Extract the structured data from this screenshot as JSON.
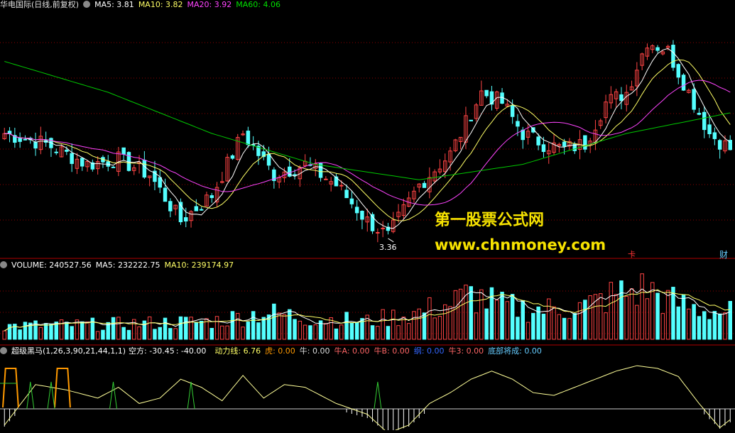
{
  "chart_data": {
    "type": "candlestick",
    "colors": {
      "up": "#ff4444",
      "down": "#54ffff",
      "ma5": "#ffffff",
      "ma10": "#ffff66",
      "ma20": "#ff44ff",
      "ma60": "#00c800",
      "grid": "#8b0000"
    },
    "main": {
      "title": "华电国际(日线,前复权)",
      "ma5_label": "MA5: 3.81",
      "ma10_label": "MA10: 3.82",
      "ma20_label": "MA20: 3.92",
      "ma60_label": "MA60: 4.06",
      "low_annotation": "3.36",
      "corner_label_left": "卡",
      "corner_label_right": "财",
      "anchors": [
        [
          0,
          4.4
        ],
        [
          8,
          4.3
        ],
        [
          16,
          4.1
        ],
        [
          22,
          4.15
        ],
        [
          28,
          4.0
        ],
        [
          34,
          3.55
        ],
        [
          40,
          3.8
        ],
        [
          46,
          4.4
        ],
        [
          52,
          4.0
        ],
        [
          58,
          4.1
        ],
        [
          64,
          3.9
        ],
        [
          70,
          3.55
        ],
        [
          74,
          3.4
        ],
        [
          80,
          3.9
        ],
        [
          86,
          4.2
        ],
        [
          92,
          4.8
        ],
        [
          96,
          4.7
        ],
        [
          100,
          4.4
        ],
        [
          104,
          4.3
        ],
        [
          108,
          4.25
        ],
        [
          112,
          4.3
        ],
        [
          116,
          4.7
        ],
        [
          120,
          4.8
        ],
        [
          124,
          5.3
        ],
        [
          128,
          5.2
        ],
        [
          132,
          4.8
        ],
        [
          136,
          4.4
        ],
        [
          140,
          4.25
        ]
      ],
      "ma60_anchors": [
        [
          0,
          5.1
        ],
        [
          20,
          4.8
        ],
        [
          40,
          4.4
        ],
        [
          60,
          4.1
        ],
        [
          80,
          3.95
        ],
        [
          100,
          4.1
        ],
        [
          120,
          4.4
        ],
        [
          140,
          4.6
        ]
      ],
      "ylim": [
        3.2,
        5.6
      ]
    },
    "volume": {
      "label": "VOLUME: 240527.56",
      "ma5_label": "MA5: 232222.75",
      "ma10_label": "MA10: 239174.97",
      "anchors": [
        [
          0,
          0.22
        ],
        [
          20,
          0.25
        ],
        [
          40,
          0.3
        ],
        [
          50,
          0.45
        ],
        [
          60,
          0.35
        ],
        [
          70,
          0.3
        ],
        [
          80,
          0.45
        ],
        [
          86,
          0.6
        ],
        [
          90,
          0.75
        ],
        [
          96,
          0.55
        ],
        [
          104,
          0.5
        ],
        [
          112,
          0.55
        ],
        [
          118,
          0.75
        ],
        [
          124,
          0.85
        ],
        [
          128,
          0.65
        ],
        [
          134,
          0.5
        ],
        [
          140,
          0.45
        ]
      ]
    },
    "indicator": {
      "name": "超级黑马(1,26,3,90,21,44,1,1)",
      "kongfang": "空方: -30.45",
      "kongfang2": ": -40.00",
      "dongli": "动力线: 6.76",
      "hu": "虎: 0.00",
      "niu": "牛: 0.00",
      "niuA": "牛A: 0.00",
      "niuB": "牛B: 0.00",
      "gang": "纲: 0.00",
      "niu3": "牛3: 0.00",
      "dibu": "底部将成: 0.00",
      "dongli_anchors": [
        [
          0,
          -0.3
        ],
        [
          6,
          0.45
        ],
        [
          12,
          0.35
        ],
        [
          18,
          0.2
        ],
        [
          22,
          0.4
        ],
        [
          26,
          0.1
        ],
        [
          30,
          0.2
        ],
        [
          34,
          0.55
        ],
        [
          38,
          0.4
        ],
        [
          42,
          0.15
        ],
        [
          46,
          0.62
        ],
        [
          50,
          0.2
        ],
        [
          54,
          0.45
        ],
        [
          58,
          0.4
        ],
        [
          64,
          0.1
        ],
        [
          70,
          -0.1
        ],
        [
          74,
          -0.45
        ],
        [
          78,
          -0.3
        ],
        [
          82,
          0.1
        ],
        [
          86,
          0.3
        ],
        [
          90,
          0.55
        ],
        [
          94,
          0.7
        ],
        [
          98,
          0.55
        ],
        [
          102,
          0.3
        ],
        [
          106,
          0.25
        ],
        [
          110,
          0.4
        ],
        [
          114,
          0.55
        ],
        [
          118,
          0.7
        ],
        [
          122,
          0.8
        ],
        [
          126,
          0.75
        ],
        [
          130,
          0.6
        ],
        [
          134,
          0.1
        ],
        [
          138,
          -0.35
        ],
        [
          140,
          -0.2
        ]
      ]
    }
  },
  "watermark": {
    "cn": "第一股票公式网",
    "url": "www.chnmoney.com"
  }
}
